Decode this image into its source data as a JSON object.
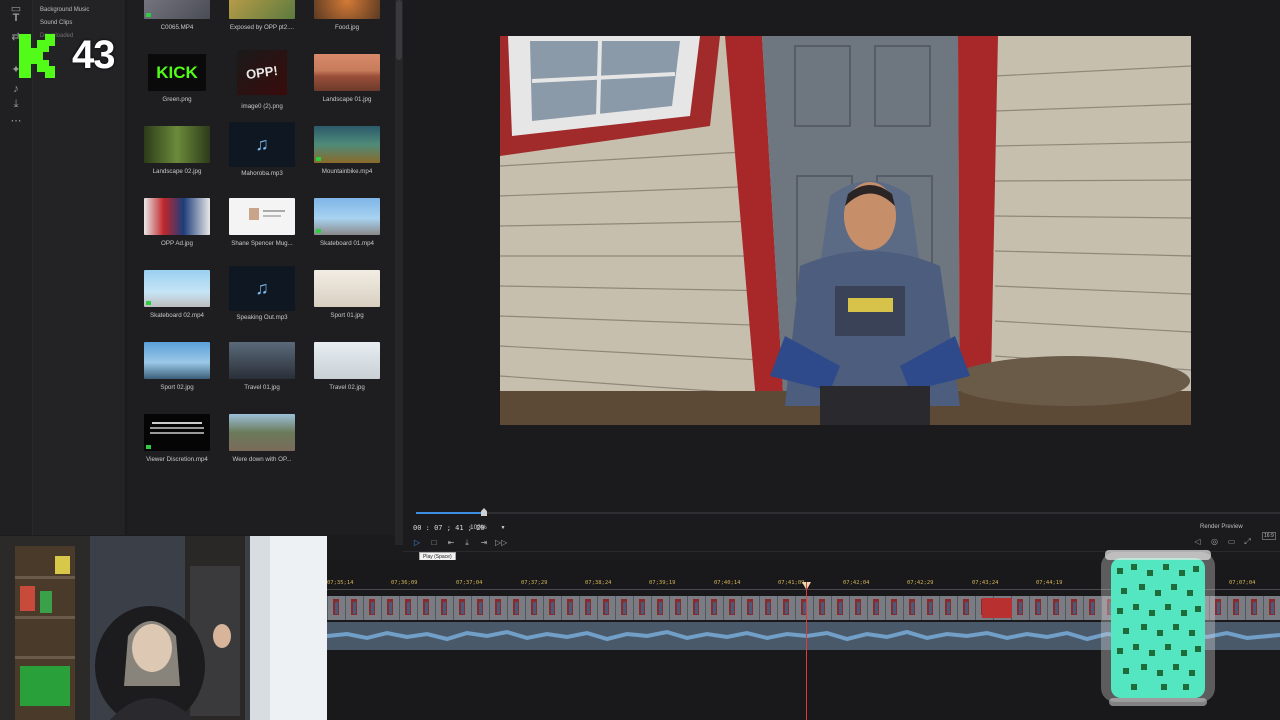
{
  "categories": [
    "Background Music",
    "Sound Clips",
    "Downloaded"
  ],
  "media": [
    {
      "label": "C0065.MP4",
      "kind": "video"
    },
    {
      "label": "Exposed by OPP pt2....",
      "kind": "image"
    },
    {
      "label": "Food.jpg",
      "kind": "image"
    },
    {
      "label": "Green.png",
      "kind": "image"
    },
    {
      "label": "image0 (2).png",
      "kind": "image"
    },
    {
      "label": "Landscape 01.jpg",
      "kind": "image"
    },
    {
      "label": "Landscape 02.jpg",
      "kind": "image"
    },
    {
      "label": "Mahoroba.mp3",
      "kind": "audio"
    },
    {
      "label": "Mountainbike.mp4",
      "kind": "video"
    },
    {
      "label": "OPP Ad.jpg",
      "kind": "image"
    },
    {
      "label": "Shane Spencer Mug...",
      "kind": "image"
    },
    {
      "label": "Skateboard 01.mp4",
      "kind": "video"
    },
    {
      "label": "Skateboard 02.mp4",
      "kind": "video"
    },
    {
      "label": "Speaking Out.mp3",
      "kind": "audio"
    },
    {
      "label": "Sport 01.jpg",
      "kind": "image"
    },
    {
      "label": "Sport 02.jpg",
      "kind": "image"
    },
    {
      "label": "Travel 01.jpg",
      "kind": "image"
    },
    {
      "label": "Travel 02.jpg",
      "kind": "image"
    },
    {
      "label": "Viewer Discretion.mp4",
      "kind": "video"
    },
    {
      "label": "Were down with OP...",
      "kind": "image"
    }
  ],
  "thumbs": {
    "green_text": "KICK",
    "opp_text": "OPP!"
  },
  "player": {
    "timecode": "00 : 07 ; 41 ; 20",
    "zoom": "100%",
    "tooltip": "Play (Space)",
    "render_preview": "Render Preview",
    "aspect": "16:9",
    "progress_fraction": 0.08
  },
  "timeline": {
    "ticks": [
      "07;35;14",
      "07;36;09",
      "07;37;04",
      "07;37;29",
      "07;38;24",
      "07;39;19",
      "07;40;14",
      "07;41;09",
      "07;42;04",
      "07;42;29",
      "07;43;24",
      "07;44;19",
      "07;07;04"
    ]
  },
  "overlay": {
    "kick_letter": "K",
    "follower_count": "43"
  },
  "colors": {
    "accent": "#3d8ee0",
    "playhead": "#e03a3a",
    "kick_green": "#53fc18",
    "ruler_text": "#d2b356"
  }
}
